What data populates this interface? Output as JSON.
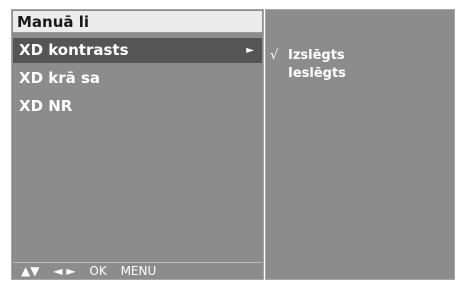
{
  "menu": {
    "title": "Manuā li",
    "items": [
      {
        "label": "XD kontrasts",
        "arrow": "►"
      },
      {
        "label": "XD krā sa"
      },
      {
        "label": "XD NR"
      }
    ]
  },
  "footer": {
    "updown": "▲▼",
    "leftright": "◄ ►",
    "ok": "OK",
    "menu": "MENU"
  },
  "submenu": {
    "check_mark": "√",
    "options": [
      {
        "label": "Izslēgts",
        "checked": true
      },
      {
        "label": "Ieslēgts",
        "checked": false
      }
    ]
  },
  "colors": {
    "panel": "#8c8c8c",
    "title_bar": "#ececec",
    "selected_row": "#555555",
    "text": "#ffffff"
  }
}
